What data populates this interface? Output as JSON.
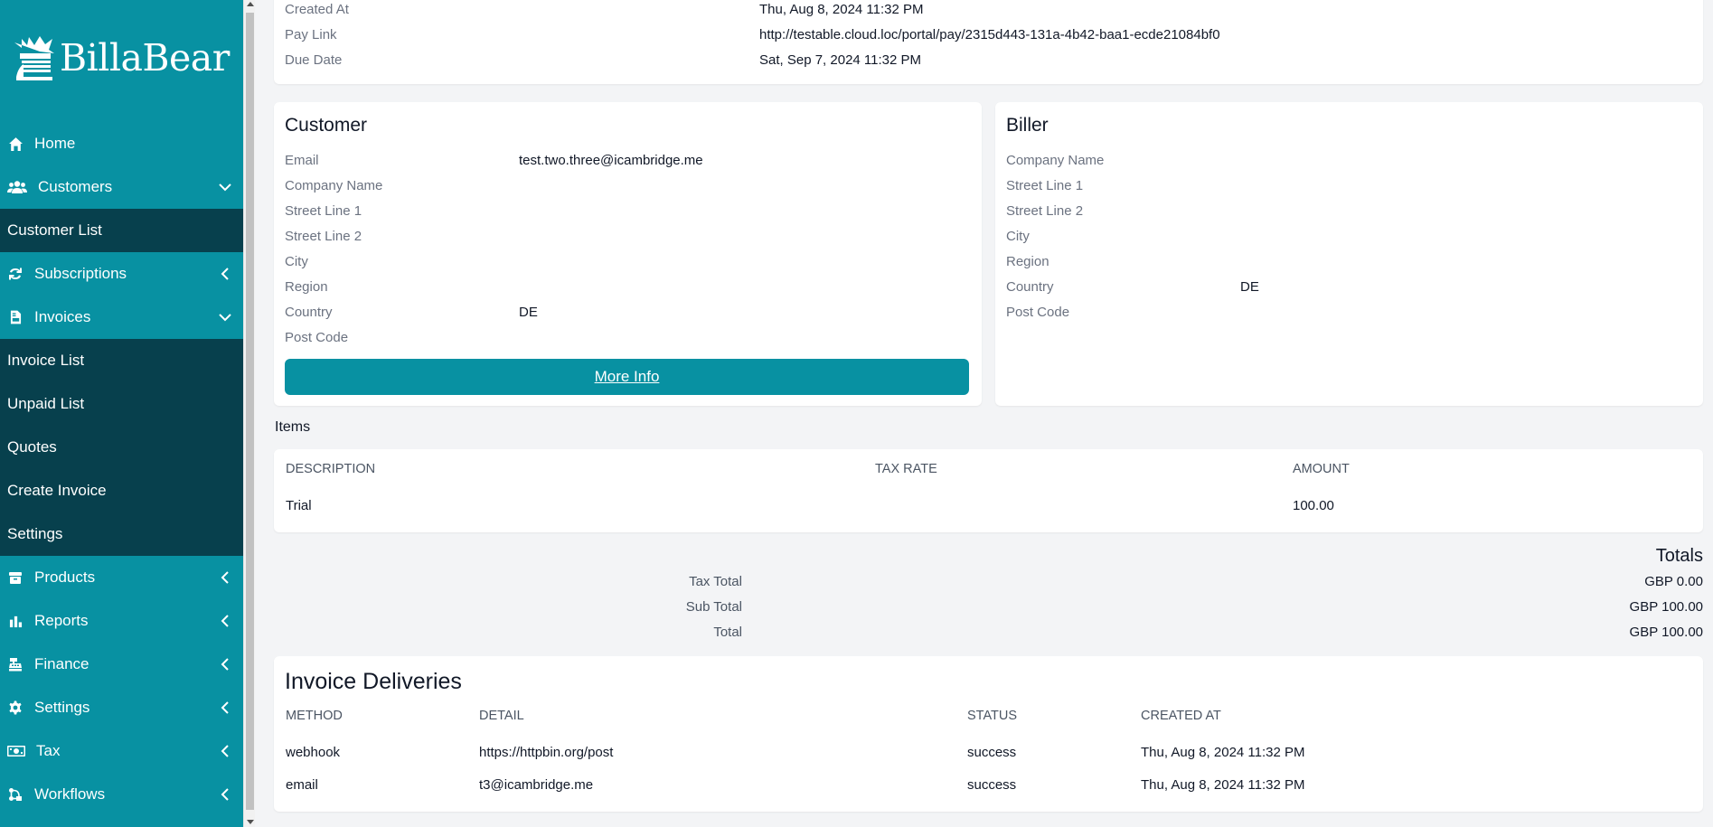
{
  "brand": {
    "name": "BillaBear"
  },
  "sidebar": {
    "items": [
      {
        "label": "Home",
        "icon": "home-icon",
        "expanded": null
      },
      {
        "label": "Customers",
        "icon": "users-icon",
        "expanded": true,
        "children": [
          "Customer List"
        ]
      },
      {
        "label": "Subscriptions",
        "icon": "refresh-icon",
        "expanded": false
      },
      {
        "label": "Invoices",
        "icon": "invoice-icon",
        "expanded": true,
        "children": [
          "Invoice List",
          "Unpaid List",
          "Quotes",
          "Create Invoice",
          "Settings"
        ]
      },
      {
        "label": "Products",
        "icon": "box-icon",
        "expanded": false
      },
      {
        "label": "Reports",
        "icon": "chart-icon",
        "expanded": false
      },
      {
        "label": "Finance",
        "icon": "cash-register-icon",
        "expanded": false
      },
      {
        "label": "Settings",
        "icon": "gear-icon",
        "expanded": false
      },
      {
        "label": "Tax",
        "icon": "money-icon",
        "expanded": false
      },
      {
        "label": "Workflows",
        "icon": "workflow-icon",
        "expanded": false
      }
    ]
  },
  "invoice_meta": {
    "created_at_label": "Created At",
    "created_at": "Thu, Aug 8, 2024 11:32 PM",
    "pay_link_label": "Pay Link",
    "pay_link": "http://testable.cloud.loc/portal/pay/2315d443-131a-4b42-baa1-ecde21084bf0",
    "due_date_label": "Due Date",
    "due_date": "Sat, Sep 7, 2024 11:32 PM"
  },
  "customer": {
    "title": "Customer",
    "fields": [
      {
        "label": "Email",
        "value": "test.two.three@icambridge.me"
      },
      {
        "label": "Company Name",
        "value": ""
      },
      {
        "label": "Street Line 1",
        "value": ""
      },
      {
        "label": "Street Line 2",
        "value": ""
      },
      {
        "label": "City",
        "value": ""
      },
      {
        "label": "Region",
        "value": ""
      },
      {
        "label": "Country",
        "value": "DE"
      },
      {
        "label": "Post Code",
        "value": ""
      }
    ],
    "more_info": "More Info"
  },
  "biller": {
    "title": "Biller",
    "fields": [
      {
        "label": "Company Name",
        "value": ""
      },
      {
        "label": "Street Line 1",
        "value": ""
      },
      {
        "label": "Street Line 2",
        "value": ""
      },
      {
        "label": "City",
        "value": ""
      },
      {
        "label": "Region",
        "value": ""
      },
      {
        "label": "Country",
        "value": "DE"
      },
      {
        "label": "Post Code",
        "value": ""
      }
    ]
  },
  "items": {
    "heading": "Items",
    "columns": [
      "Description",
      "Tax Rate",
      "Amount"
    ],
    "rows": [
      {
        "description": "Trial",
        "tax_rate": "",
        "amount": "100.00"
      }
    ]
  },
  "totals": {
    "heading": "Totals",
    "rows": [
      {
        "label": "Tax Total",
        "value": "GBP 0.00"
      },
      {
        "label": "Sub Total",
        "value": "GBP 100.00"
      },
      {
        "label": "Total",
        "value": "GBP 100.00"
      }
    ]
  },
  "deliveries": {
    "title": "Invoice Deliveries",
    "columns": [
      "Method",
      "Detail",
      "Status",
      "Created At"
    ],
    "rows": [
      {
        "method": "webhook",
        "detail": "https://httpbin.org/post",
        "status": "success",
        "created_at": "Thu, Aug 8, 2024 11:32 PM"
      },
      {
        "method": "email",
        "detail": "t3@icambridge.me",
        "status": "success",
        "created_at": "Thu, Aug 8, 2024 11:32 PM"
      }
    ]
  }
}
